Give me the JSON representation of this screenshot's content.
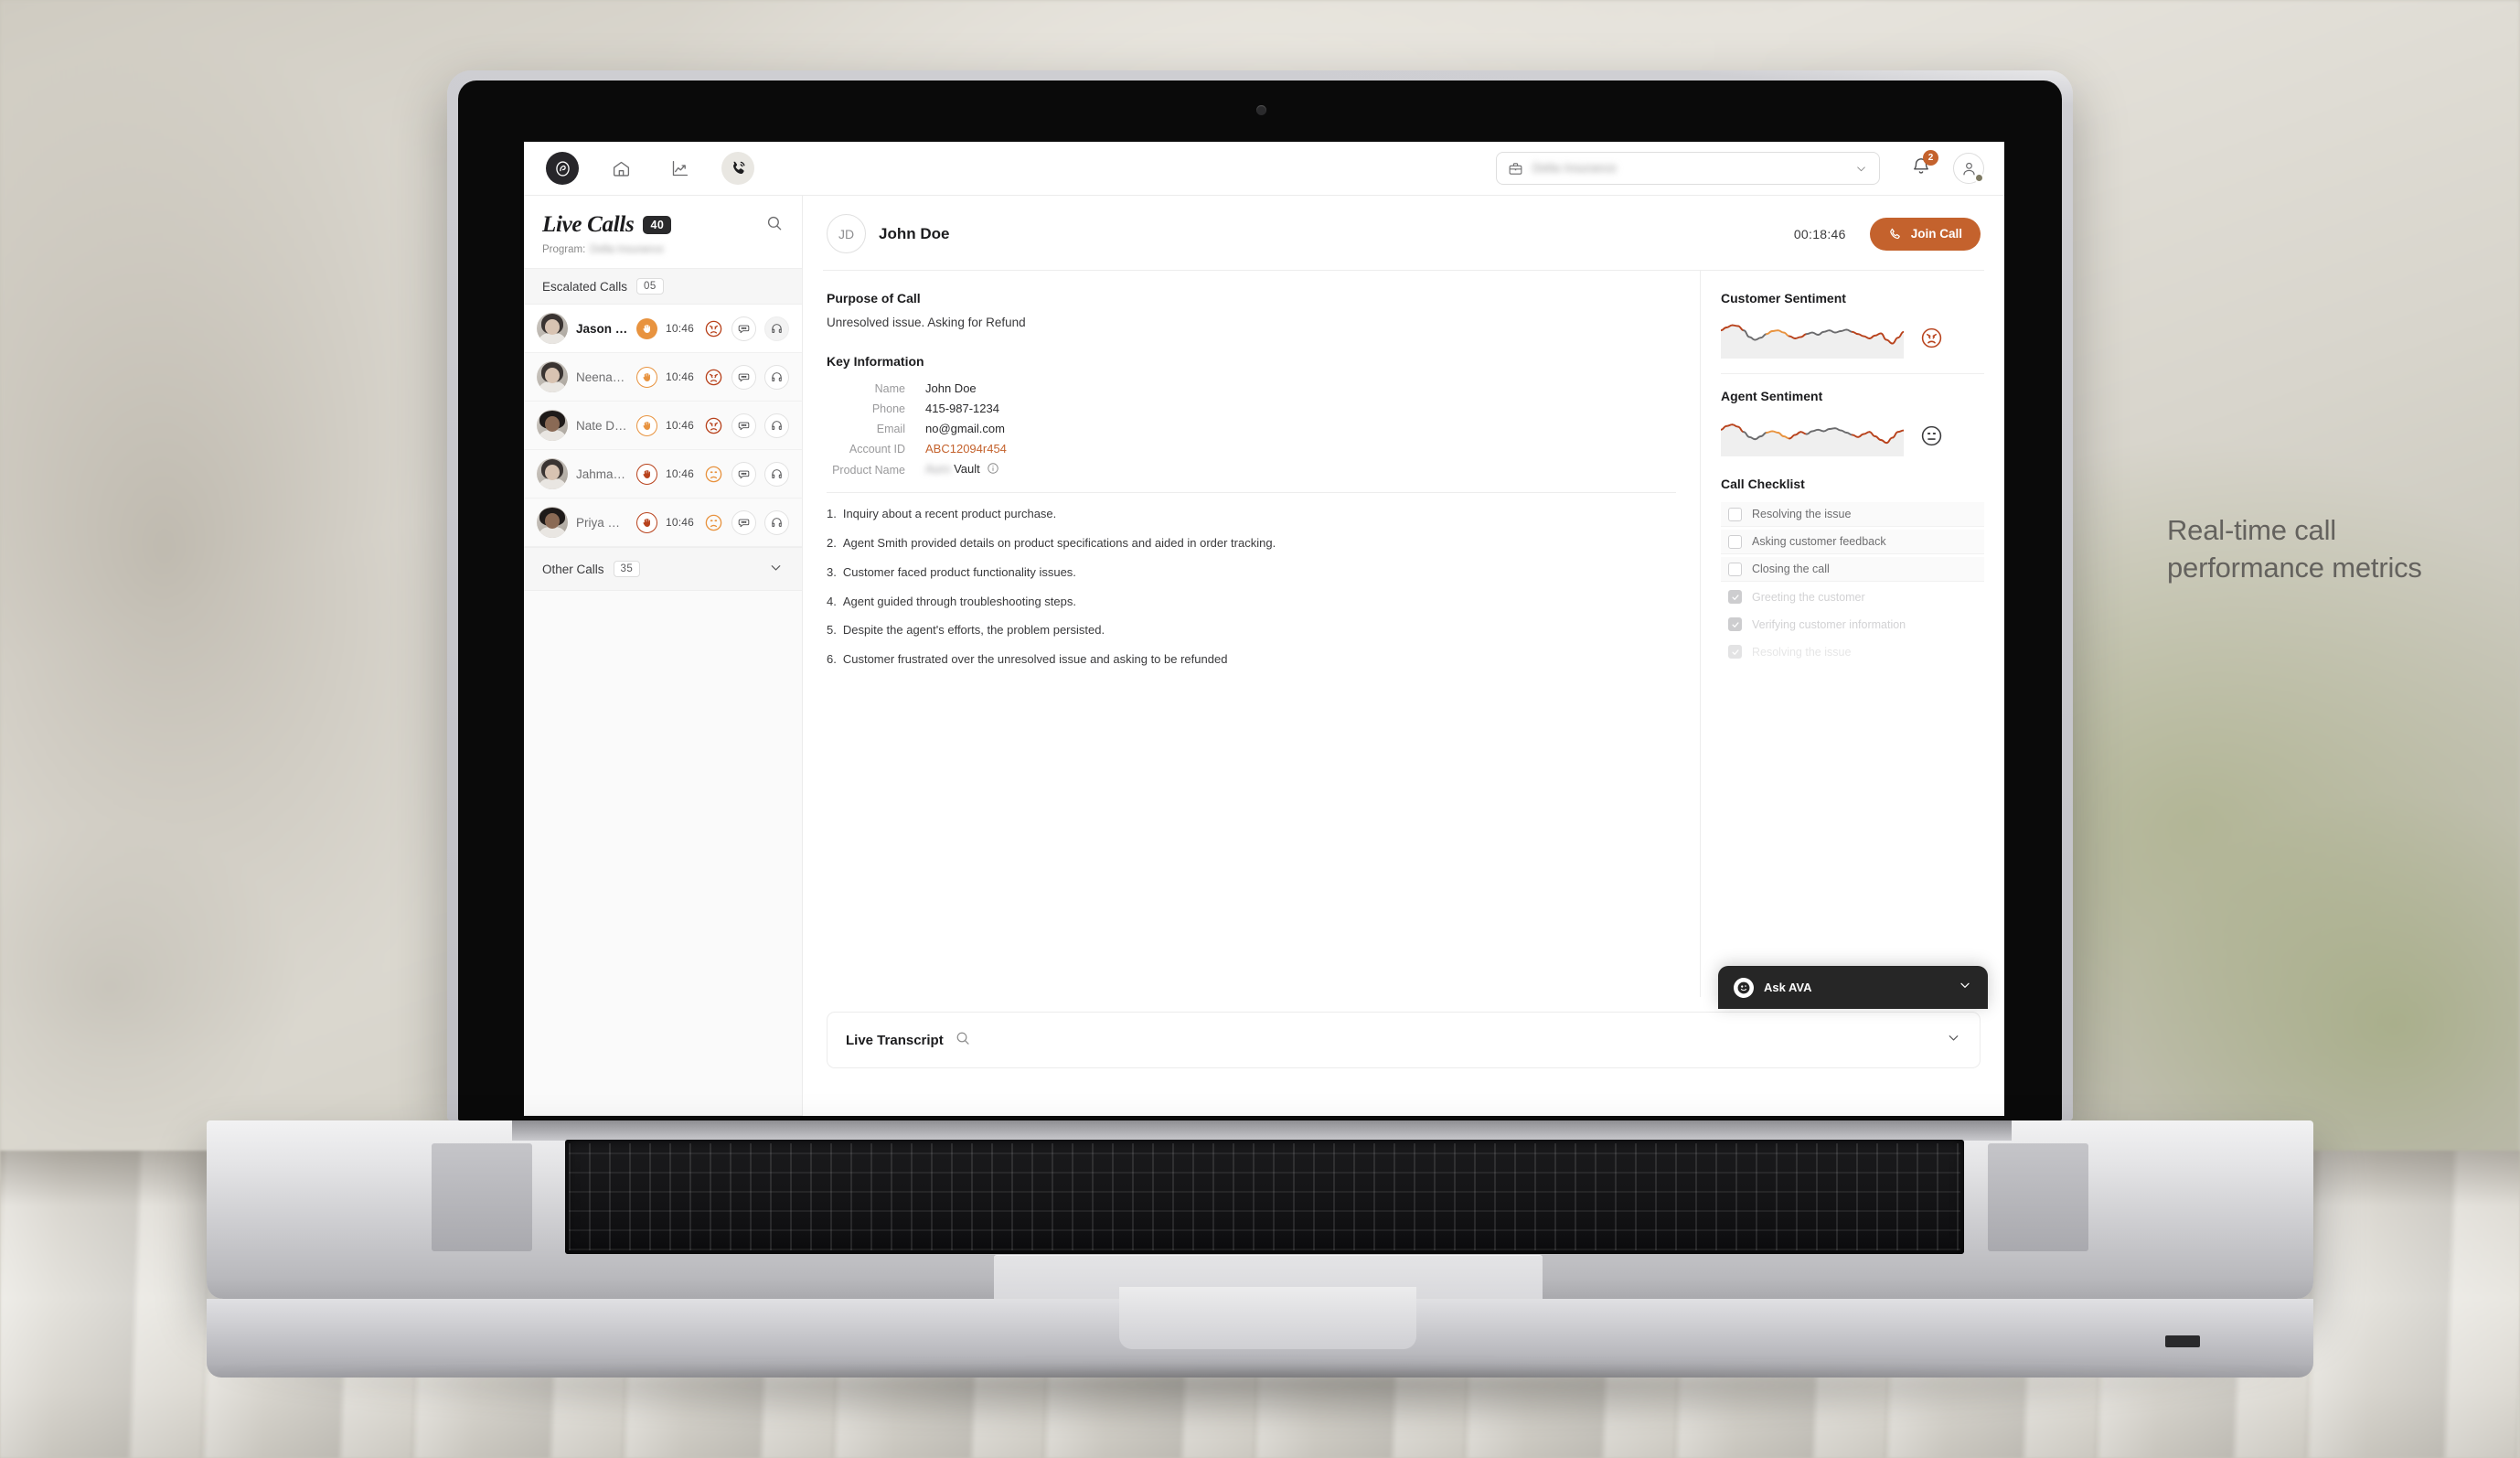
{
  "caption": "Real-time call performance metrics",
  "navbar": {
    "logo_icon": "ava-logo-icon",
    "items": [
      {
        "name": "home",
        "icon": "home-icon",
        "active": false
      },
      {
        "name": "analytics",
        "icon": "trending-up-chart-icon",
        "active": false
      },
      {
        "name": "calls",
        "icon": "phone-call-icon",
        "active": true
      }
    ],
    "program_selector": {
      "icon": "briefcase-icon",
      "value": "Delta Insurance",
      "redacted": true,
      "chevron": "chevron-down-icon"
    },
    "notifications": {
      "icon": "bell-icon",
      "count": "2"
    },
    "account": {
      "icon": "user-avatar-icon",
      "status": "online"
    }
  },
  "sidebar": {
    "title": "Live Calls",
    "count": "40",
    "search_icon": "search-icon",
    "program_label": "Program:",
    "program_value": "Delta Insurance",
    "escalated": {
      "label": "Escalated Calls",
      "count": "05"
    },
    "other": {
      "label": "Other Calls",
      "count": "35",
      "chevron": "chevron-down-icon"
    },
    "calls": [
      {
        "name": "Jason Welsh",
        "time": "10:46",
        "hand": "solid",
        "sentiment": "angry",
        "selected": true,
        "avatar": "light",
        "chat_icon": "chat-bubble-icon",
        "listen_icon": "headphones-icon"
      },
      {
        "name": "Neenah Dunn",
        "time": "10:46",
        "hand": "out",
        "sentiment": "angry",
        "selected": false,
        "avatar": "light",
        "chat_icon": "chat-bubble-icon",
        "listen_icon": "headphones-icon"
      },
      {
        "name": "Nate Daven...",
        "time": "10:46",
        "hand": "out",
        "sentiment": "angry",
        "selected": false,
        "avatar": "dark",
        "chat_icon": "chat-bubble-icon",
        "listen_icon": "headphones-icon"
      },
      {
        "name": "Jahmal Attari",
        "time": "10:46",
        "hand": "red",
        "sentiment": "frown",
        "selected": false,
        "avatar": "light",
        "chat_icon": "chat-bubble-icon",
        "listen_icon": "headphones-icon"
      },
      {
        "name": "Priya Subra...",
        "time": "10:46",
        "hand": "red",
        "sentiment": "frown",
        "selected": false,
        "avatar": "dark",
        "chat_icon": "chat-bubble-icon",
        "listen_icon": "headphones-icon"
      }
    ]
  },
  "main": {
    "customer_initials": "JD",
    "customer_name": "John Doe",
    "duration": "00:18:46",
    "join_label": "Join Call",
    "join_icon": "phone-icon",
    "join_color": "#c4622d",
    "purpose_title": "Purpose of Call",
    "purpose_text": "Unresolved issue. Asking for Refund",
    "key_info_title": "Key Information",
    "key_info": [
      {
        "key": "Name",
        "value": "John Doe",
        "accent": false,
        "redacted": false,
        "info_icon": false
      },
      {
        "key": "Phone",
        "value": "415-987-1234",
        "accent": false,
        "redacted": false,
        "info_icon": false
      },
      {
        "key": "Email",
        "value": "no@gmail.com",
        "accent": false,
        "redacted": false,
        "info_icon": false
      },
      {
        "key": "Account ID",
        "value": "ABC12094r454",
        "accent": true,
        "redacted": false,
        "info_icon": false
      },
      {
        "key": "Product Name",
        "value": "Vault",
        "accent": false,
        "redacted": true,
        "redacted_prefix": "Auro",
        "info_icon": true
      }
    ],
    "notes": [
      {
        "n": "1.",
        "text": "Inquiry about a recent product purchase."
      },
      {
        "n": "2.",
        "text": "Agent Smith provided details on product specifications and aided in order tracking."
      },
      {
        "n": "3.",
        "text": "Customer faced product functionality issues."
      },
      {
        "n": "4.",
        "text": "Agent guided through troubleshooting steps."
      },
      {
        "n": "5.",
        "text": "Despite the agent's efforts, the problem persisted."
      },
      {
        "n": "6.",
        "text": "Customer frustrated over the unresolved issue and asking to be refunded"
      }
    ],
    "transcript": {
      "title": "Live Transcript",
      "search_icon": "search-icon",
      "chevron": "chevron-down-icon"
    },
    "ask_ava": {
      "label": "Ask AVA",
      "icon": "ava-face-icon",
      "chevron": "chevron-down-icon",
      "bg": "#262626"
    }
  },
  "right_panel": {
    "customer_sentiment": {
      "title": "Customer Sentiment",
      "emoji": "angry-face-icon",
      "emoji_color": "#b8421c"
    },
    "agent_sentiment": {
      "title": "Agent Sentiment",
      "emoji": "neutral-face-icon",
      "emoji_color": "#3a3a3c"
    },
    "checklist_title": "Call Checklist",
    "checklist": [
      {
        "label": "Resolving the issue",
        "checked": false,
        "fade": 0
      },
      {
        "label": "Asking customer feedback",
        "checked": false,
        "fade": 0
      },
      {
        "label": "Closing the call",
        "checked": false,
        "fade": 0
      },
      {
        "label": "Greeting the customer",
        "checked": true,
        "fade": 1
      },
      {
        "label": "Verifying customer information",
        "checked": true,
        "fade": 1
      },
      {
        "label": "Resolving the issue",
        "checked": true,
        "fade": 2
      }
    ]
  },
  "chart_data": [
    {
      "type": "line",
      "title": "Customer Sentiment",
      "x": [
        0,
        1,
        2,
        3,
        4,
        5,
        6,
        7,
        8,
        9,
        10,
        11,
        12,
        13,
        14,
        15,
        16,
        17,
        18,
        19,
        20,
        21,
        22,
        23,
        24,
        25,
        26,
        27,
        28,
        29,
        30,
        31,
        32
      ],
      "values": [
        62,
        70,
        76,
        74,
        62,
        44,
        36,
        42,
        52,
        60,
        62,
        56,
        46,
        40,
        44,
        52,
        56,
        50,
        58,
        62,
        56,
        60,
        64,
        58,
        52,
        46,
        40,
        48,
        54,
        36,
        26,
        42,
        58
      ],
      "segment_colors": [
        "#b8421c",
        "#b8421c",
        "#b8421c",
        "#b8421c",
        "#6b6b6d",
        "#6b6b6d",
        "#6b6b6d",
        "#6b6b6d",
        "#e8933f",
        "#e8933f",
        "#e8933f",
        "#e8933f",
        "#b8421c",
        "#b8421c",
        "#b8421c",
        "#6b6b6d",
        "#6b6b6d",
        "#6b6b6d",
        "#6b6b6d",
        "#6b6b6d",
        "#6b6b6d",
        "#6b6b6d",
        "#6b6b6d",
        "#b8421c",
        "#b8421c",
        "#b8421c",
        "#b8421c",
        "#b8421c",
        "#b8421c",
        "#b8421c",
        "#b8421c",
        "#b8421c",
        "#b8421c"
      ],
      "ylim": [
        0,
        100
      ],
      "grid": false,
      "legend": "none",
      "fill": "#efefef"
    },
    {
      "type": "line",
      "title": "Agent Sentiment",
      "x": [
        0,
        1,
        2,
        3,
        4,
        5,
        6,
        7,
        8,
        9,
        10,
        11,
        12,
        13,
        14,
        15,
        16,
        17,
        18,
        19,
        20,
        21,
        22,
        23,
        24,
        25,
        26,
        27,
        28,
        29,
        30,
        31,
        32
      ],
      "values": [
        58,
        68,
        72,
        66,
        52,
        38,
        32,
        40,
        50,
        54,
        50,
        40,
        34,
        44,
        52,
        46,
        54,
        58,
        54,
        60,
        62,
        56,
        50,
        44,
        38,
        46,
        52,
        40,
        30,
        22,
        36,
        52,
        56
      ],
      "segment_colors": [
        "#b8421c",
        "#b8421c",
        "#b8421c",
        "#b8421c",
        "#6b6b6d",
        "#6b6b6d",
        "#6b6b6d",
        "#6b6b6d",
        "#e8933f",
        "#e8933f",
        "#e8933f",
        "#e8933f",
        "#b8421c",
        "#b8421c",
        "#b8421c",
        "#6b6b6d",
        "#6b6b6d",
        "#6b6b6d",
        "#6b6b6d",
        "#6b6b6d",
        "#6b6b6d",
        "#6b6b6d",
        "#6b6b6d",
        "#b8421c",
        "#b8421c",
        "#b8421c",
        "#b8421c",
        "#b8421c",
        "#b8421c",
        "#b8421c",
        "#b8421c",
        "#b8421c",
        "#b8421c"
      ],
      "ylim": [
        0,
        100
      ],
      "grid": false,
      "legend": "none",
      "fill": "#efefef"
    }
  ]
}
